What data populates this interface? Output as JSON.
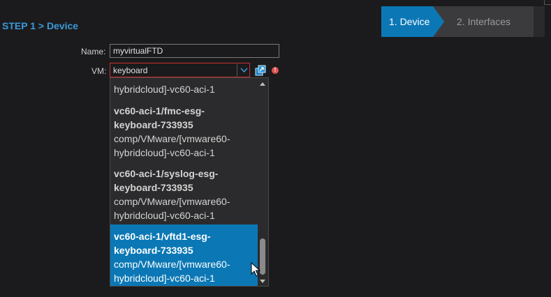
{
  "step_title": "STEP 1 > Device",
  "wizard": {
    "steps": [
      {
        "label": "1. Device",
        "active": true
      },
      {
        "label": "2. Interfaces",
        "active": false
      }
    ]
  },
  "form": {
    "name_label": "Name:",
    "name_value": "myvirtualFTD",
    "vm_label": "VM:",
    "vm_value": "keyboard"
  },
  "dropdown": {
    "options": [
      {
        "lines": [
          "hybridcloud]-vc60-aci-1"
        ],
        "bold_lines": 0,
        "selected": false
      },
      {
        "lines": [
          "vc60-aci-1/fmc-esg-",
          "keyboard-733935",
          "comp/VMware/[vmware60-",
          "hybridcloud]-vc60-aci-1"
        ],
        "bold_lines": 2,
        "selected": false
      },
      {
        "lines": [
          "vc60-aci-1/syslog-esg-",
          "keyboard-733935",
          "comp/VMware/[vmware60-",
          "hybridcloud]-vc60-aci-1"
        ],
        "bold_lines": 2,
        "selected": false
      },
      {
        "lines": [
          "vc60-aci-1/vftd1-esg-",
          "keyboard-733935",
          "comp/VMware/[vmware60-",
          "hybridcloud]-vc60-aci-1"
        ],
        "bold_lines": 2,
        "selected": true
      }
    ]
  },
  "colors": {
    "accent": "#0b78b5",
    "error": "#c9302c",
    "title": "#3a9ad9"
  },
  "icons": [
    "chevron-down-icon",
    "copy-icon",
    "alert-icon",
    "scroll-up-icon",
    "scroll-down-icon",
    "mouse-cursor-icon"
  ]
}
